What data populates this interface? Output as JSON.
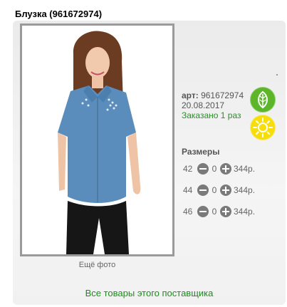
{
  "product": {
    "title": "Блузка (961672974)",
    "more_photos": "Ещё фото",
    "article_label": "арт:",
    "article_value": "961672974",
    "date": "20.08.2017",
    "ordered": "Заказано 1 раз"
  },
  "sizes": {
    "heading": "Размеры",
    "rows": [
      {
        "size": "42",
        "qty": "0",
        "price": "344р."
      },
      {
        "size": "44",
        "qty": "0",
        "price": "344р."
      },
      {
        "size": "46",
        "qty": "0",
        "price": "344р."
      }
    ]
  },
  "footer": {
    "supplier_link": "Все товары этого поставщика"
  },
  "colors": {
    "eco_badge": "#5db52a",
    "sun_badge": "#f7de0a",
    "link_green": "#1e8a1e"
  },
  "icons": {
    "eco": "leaf-icon",
    "sun": "sun-icon",
    "minus": "minus-icon",
    "plus": "plus-icon"
  }
}
